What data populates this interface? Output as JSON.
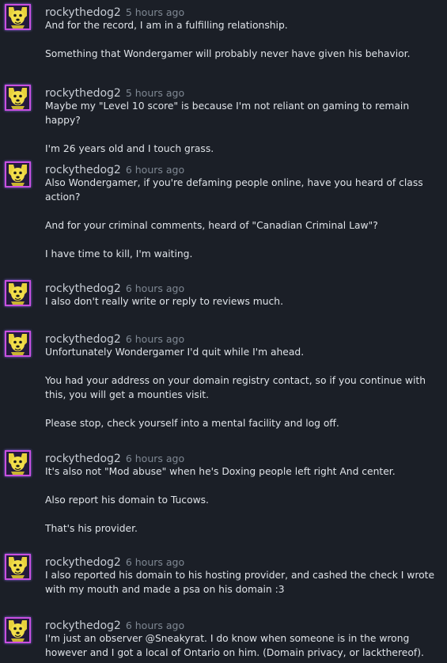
{
  "comments": [
    {
      "author": "rockythedog2",
      "time": "5 hours ago",
      "paragraphs": [
        "And for the record, I am in a fulfilling relationship.",
        "Something that Wondergamer will probably never have given his behavior."
      ]
    },
    {
      "author": "rockythedog2",
      "time": "5 hours ago",
      "paragraphs": [
        "Maybe my \"Level 10 score\" is because I'm not reliant on gaming to remain happy?",
        "I'm 26 years old and I touch grass."
      ]
    },
    {
      "author": "rockythedog2",
      "time": "6 hours ago",
      "paragraphs": [
        "Also Wondergamer, if you're defaming people online, have you heard of class action?",
        "And for your criminal comments, heard of \"Canadian Criminal Law\"?",
        "I have time to kill, I'm waiting."
      ]
    },
    {
      "author": "rockythedog2",
      "time": "6 hours ago",
      "paragraphs": [
        "I also don't really write or reply to reviews much."
      ]
    },
    {
      "author": "rockythedog2",
      "time": "6 hours ago",
      "paragraphs": [
        "Unfortunately Wondergamer I'd quit while I'm ahead.",
        "You had your address on your domain registry contact, so if you continue with this, you will get a mounties visit.",
        "Please stop, check yourself into a mental facility and log off."
      ]
    },
    {
      "author": "rockythedog2",
      "time": "6 hours ago",
      "paragraphs": [
        "It's also not \"Mod abuse\" when he's Doxing people left right And center.",
        "Also report his domain to Tucows.",
        "That's his provider."
      ]
    },
    {
      "author": "rockythedog2",
      "time": "6 hours ago",
      "paragraphs": [
        "I also reported his domain to his hosting provider, and cashed the check I wrote with my mouth and made a psa on his domain :3"
      ]
    },
    {
      "author": "rockythedog2",
      "time": "6 hours ago",
      "paragraphs": [
        "I'm just an observer @Sneakyrat. I do know when someone is in the wrong however and I got a local of Ontario on him. (Domain privacy, or lackthereof)."
      ]
    }
  ],
  "colors": {
    "background": "#1b1f27",
    "author": "#c7ccd4",
    "timestamp": "#7f8893",
    "text": "#dfe3e8",
    "avatar_border": "#c94fe0"
  },
  "avatar_icon": "yellow-dog-avatar-icon"
}
